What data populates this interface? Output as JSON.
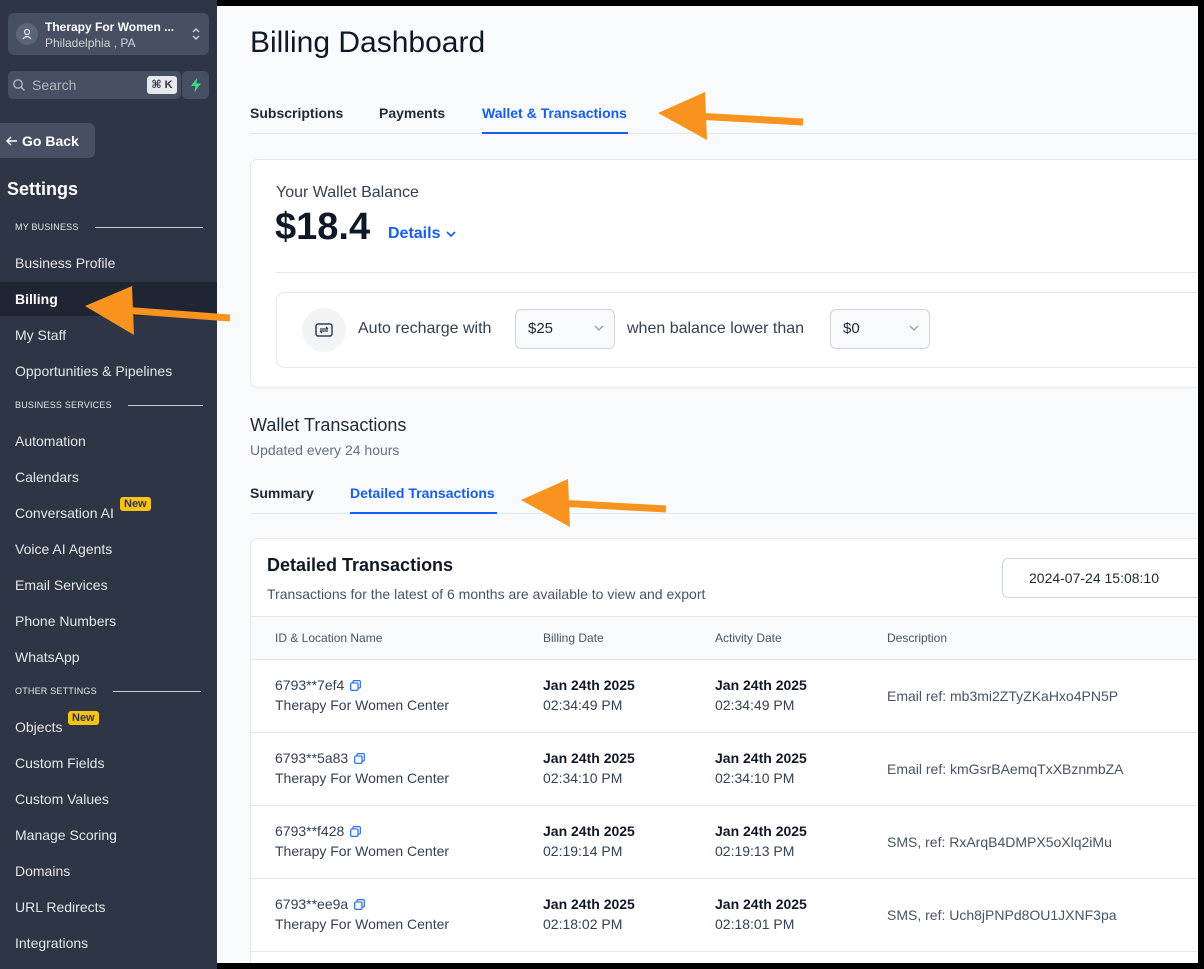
{
  "sidebar": {
    "location_name": "Therapy For Women ...",
    "location_city": "Philadelphia , PA",
    "search_placeholder": "Search",
    "search_shortcut": "⌘ K",
    "go_back": "Go Back",
    "settings_title": "Settings",
    "sections": {
      "my_business": "MY BUSINESS",
      "business_services": "BUSINESS SERVICES",
      "other_settings": "OTHER SETTINGS"
    },
    "items": {
      "business_profile": "Business Profile",
      "billing": "Billing",
      "my_staff": "My Staff",
      "opportunities": "Opportunities & Pipelines",
      "automation": "Automation",
      "calendars": "Calendars",
      "conversation_ai": "Conversation AI",
      "voice_ai": "Voice AI Agents",
      "email_services": "Email Services",
      "phone_numbers": "Phone Numbers",
      "whatsapp": "WhatsApp",
      "objects": "Objects",
      "custom_fields": "Custom Fields",
      "custom_values": "Custom Values",
      "manage_scoring": "Manage Scoring",
      "domains": "Domains",
      "url_redirects": "URL Redirects",
      "integrations": "Integrations"
    },
    "new_badge": "New"
  },
  "main": {
    "page_title": "Billing Dashboard",
    "tabs": {
      "subscriptions": "Subscriptions",
      "payments": "Payments",
      "wallet": "Wallet & Transactions"
    },
    "wallet": {
      "label": "Your Wallet Balance",
      "amount": "$18.4",
      "details": "Details",
      "auto_recharge_text": "Auto recharge with",
      "recharge_amount": "$25",
      "when_text": "when balance lower than",
      "threshold": "$0"
    },
    "wallet_transactions": {
      "title": "Wallet Transactions",
      "subtitle": "Updated every 24 hours",
      "tabs": {
        "summary": "Summary",
        "detailed": "Detailed Transactions"
      }
    },
    "detailed": {
      "title": "Detailed Transactions",
      "subtitle": "Transactions for the latest of 6 months are available to view and export",
      "date_range": "2024-07-24 15:08:10",
      "columns": {
        "id": "ID & Location Name",
        "billing": "Billing Date",
        "activity": "Activity Date",
        "description": "Description"
      },
      "rows": [
        {
          "id": "6793**7ef4",
          "location": "Therapy For Women Center",
          "billing_date": "Jan 24th 2025",
          "billing_time": "02:34:49 PM",
          "activity_date": "Jan 24th 2025",
          "activity_time": "02:34:49 PM",
          "description": "Email ref: mb3mi2ZTyZKaHxo4PN5P"
        },
        {
          "id": "6793**5a83",
          "location": "Therapy For Women Center",
          "billing_date": "Jan 24th 2025",
          "billing_time": "02:34:10 PM",
          "activity_date": "Jan 24th 2025",
          "activity_time": "02:34:10 PM",
          "description": "Email ref: kmGsrBAemqTxXBznmbZA"
        },
        {
          "id": "6793**f428",
          "location": "Therapy For Women Center",
          "billing_date": "Jan 24th 2025",
          "billing_time": "02:19:14 PM",
          "activity_date": "Jan 24th 2025",
          "activity_time": "02:19:13 PM",
          "description": "SMS, ref: RxArqB4DMPX5oXlq2iMu"
        },
        {
          "id": "6793**ee9a",
          "location": "Therapy For Women Center",
          "billing_date": "Jan 24th 2025",
          "billing_time": "02:18:02 PM",
          "activity_date": "Jan 24th 2025",
          "activity_time": "02:18:01 PM",
          "description": "SMS, ref: Uch8jPNPd8OU1JXNF3pa"
        }
      ]
    }
  },
  "colors": {
    "sidebar_bg": "#2e3646",
    "accent": "#155eef",
    "annotation_arrow": "#f7931e",
    "badge": "#f7c21a"
  }
}
